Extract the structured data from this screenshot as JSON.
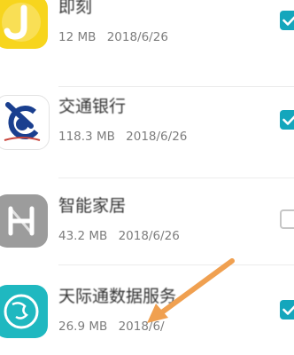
{
  "apps": [
    {
      "name": "即刻",
      "size": "12 MB",
      "date": "2018/6/26",
      "checked": true,
      "icon": "jike-icon"
    },
    {
      "name": "交通银行",
      "size": "118.3 MB",
      "date": "2018/6/26",
      "checked": true,
      "icon": "bocom-icon"
    },
    {
      "name": "智能家居",
      "size": "43.2 MB",
      "date": "2018/6/26",
      "checked": false,
      "icon": "smart-home-icon"
    },
    {
      "name": "天际通数据服务",
      "size": "26.9 MB",
      "date": "2018/6/",
      "checked": true,
      "icon": "globe-icon"
    }
  ],
  "colors": {
    "accent": "#14a6bc",
    "arrow": "#f0a050"
  }
}
